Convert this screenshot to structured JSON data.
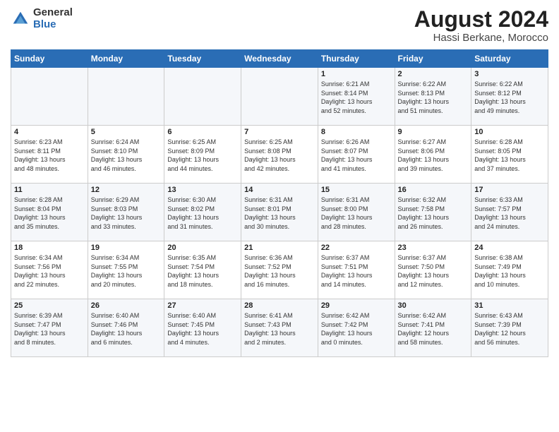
{
  "header": {
    "logo_general": "General",
    "logo_blue": "Blue",
    "title": "August 2024",
    "subtitle": "Hassi Berkane, Morocco"
  },
  "weekdays": [
    "Sunday",
    "Monday",
    "Tuesday",
    "Wednesday",
    "Thursday",
    "Friday",
    "Saturday"
  ],
  "rows": [
    [
      {
        "num": "",
        "info": ""
      },
      {
        "num": "",
        "info": ""
      },
      {
        "num": "",
        "info": ""
      },
      {
        "num": "",
        "info": ""
      },
      {
        "num": "1",
        "info": "Sunrise: 6:21 AM\nSunset: 8:14 PM\nDaylight: 13 hours\nand 52 minutes."
      },
      {
        "num": "2",
        "info": "Sunrise: 6:22 AM\nSunset: 8:13 PM\nDaylight: 13 hours\nand 51 minutes."
      },
      {
        "num": "3",
        "info": "Sunrise: 6:22 AM\nSunset: 8:12 PM\nDaylight: 13 hours\nand 49 minutes."
      }
    ],
    [
      {
        "num": "4",
        "info": "Sunrise: 6:23 AM\nSunset: 8:11 PM\nDaylight: 13 hours\nand 48 minutes."
      },
      {
        "num": "5",
        "info": "Sunrise: 6:24 AM\nSunset: 8:10 PM\nDaylight: 13 hours\nand 46 minutes."
      },
      {
        "num": "6",
        "info": "Sunrise: 6:25 AM\nSunset: 8:09 PM\nDaylight: 13 hours\nand 44 minutes."
      },
      {
        "num": "7",
        "info": "Sunrise: 6:25 AM\nSunset: 8:08 PM\nDaylight: 13 hours\nand 42 minutes."
      },
      {
        "num": "8",
        "info": "Sunrise: 6:26 AM\nSunset: 8:07 PM\nDaylight: 13 hours\nand 41 minutes."
      },
      {
        "num": "9",
        "info": "Sunrise: 6:27 AM\nSunset: 8:06 PM\nDaylight: 13 hours\nand 39 minutes."
      },
      {
        "num": "10",
        "info": "Sunrise: 6:28 AM\nSunset: 8:05 PM\nDaylight: 13 hours\nand 37 minutes."
      }
    ],
    [
      {
        "num": "11",
        "info": "Sunrise: 6:28 AM\nSunset: 8:04 PM\nDaylight: 13 hours\nand 35 minutes."
      },
      {
        "num": "12",
        "info": "Sunrise: 6:29 AM\nSunset: 8:03 PM\nDaylight: 13 hours\nand 33 minutes."
      },
      {
        "num": "13",
        "info": "Sunrise: 6:30 AM\nSunset: 8:02 PM\nDaylight: 13 hours\nand 31 minutes."
      },
      {
        "num": "14",
        "info": "Sunrise: 6:31 AM\nSunset: 8:01 PM\nDaylight: 13 hours\nand 30 minutes."
      },
      {
        "num": "15",
        "info": "Sunrise: 6:31 AM\nSunset: 8:00 PM\nDaylight: 13 hours\nand 28 minutes."
      },
      {
        "num": "16",
        "info": "Sunrise: 6:32 AM\nSunset: 7:58 PM\nDaylight: 13 hours\nand 26 minutes."
      },
      {
        "num": "17",
        "info": "Sunrise: 6:33 AM\nSunset: 7:57 PM\nDaylight: 13 hours\nand 24 minutes."
      }
    ],
    [
      {
        "num": "18",
        "info": "Sunrise: 6:34 AM\nSunset: 7:56 PM\nDaylight: 13 hours\nand 22 minutes."
      },
      {
        "num": "19",
        "info": "Sunrise: 6:34 AM\nSunset: 7:55 PM\nDaylight: 13 hours\nand 20 minutes."
      },
      {
        "num": "20",
        "info": "Sunrise: 6:35 AM\nSunset: 7:54 PM\nDaylight: 13 hours\nand 18 minutes."
      },
      {
        "num": "21",
        "info": "Sunrise: 6:36 AM\nSunset: 7:52 PM\nDaylight: 13 hours\nand 16 minutes."
      },
      {
        "num": "22",
        "info": "Sunrise: 6:37 AM\nSunset: 7:51 PM\nDaylight: 13 hours\nand 14 minutes."
      },
      {
        "num": "23",
        "info": "Sunrise: 6:37 AM\nSunset: 7:50 PM\nDaylight: 13 hours\nand 12 minutes."
      },
      {
        "num": "24",
        "info": "Sunrise: 6:38 AM\nSunset: 7:49 PM\nDaylight: 13 hours\nand 10 minutes."
      }
    ],
    [
      {
        "num": "25",
        "info": "Sunrise: 6:39 AM\nSunset: 7:47 PM\nDaylight: 13 hours\nand 8 minutes."
      },
      {
        "num": "26",
        "info": "Sunrise: 6:40 AM\nSunset: 7:46 PM\nDaylight: 13 hours\nand 6 minutes."
      },
      {
        "num": "27",
        "info": "Sunrise: 6:40 AM\nSunset: 7:45 PM\nDaylight: 13 hours\nand 4 minutes."
      },
      {
        "num": "28",
        "info": "Sunrise: 6:41 AM\nSunset: 7:43 PM\nDaylight: 13 hours\nand 2 minutes."
      },
      {
        "num": "29",
        "info": "Sunrise: 6:42 AM\nSunset: 7:42 PM\nDaylight: 13 hours\nand 0 minutes."
      },
      {
        "num": "30",
        "info": "Sunrise: 6:42 AM\nSunset: 7:41 PM\nDaylight: 12 hours\nand 58 minutes."
      },
      {
        "num": "31",
        "info": "Sunrise: 6:43 AM\nSunset: 7:39 PM\nDaylight: 12 hours\nand 56 minutes."
      }
    ]
  ]
}
